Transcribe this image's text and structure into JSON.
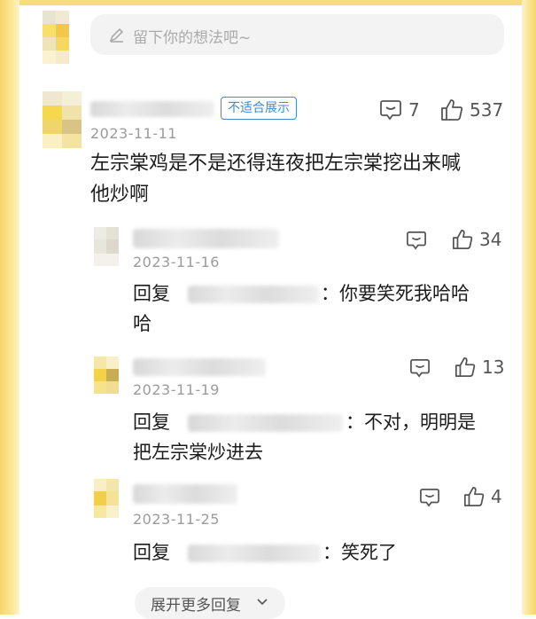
{
  "comment_input": {
    "placeholder": "留下你的想法吧~"
  },
  "main_comment": {
    "badge": "不适合展示",
    "date": "2023-11-11",
    "text_line1": "左宗棠鸡是不是还得连夜把左宗棠挖出来喊",
    "text_line2": "他炒啊",
    "reply_count": "7",
    "like_count": "537"
  },
  "replies": [
    {
      "date": "2023-11-16",
      "prefix": "回复",
      "text_tail": "：你要笑死我哈哈",
      "text_line2": "哈",
      "like_count": "34"
    },
    {
      "date": "2023-11-19",
      "prefix": "回复",
      "text_tail": "：不对，明明是",
      "text_line2": "把左宗棠炒进去",
      "like_count": "13"
    },
    {
      "date": "2023-11-25",
      "prefix": "回复",
      "text_tail": "：笑死了",
      "text_line2": "",
      "like_count": "4"
    }
  ],
  "expand_more": {
    "label": "展开更多回复"
  },
  "icons": {
    "comment": "comment-bubble-icon",
    "like": "thumbs-up-icon",
    "edit": "pencil-icon",
    "expand": "chevron-down-icon"
  },
  "colors": {
    "frame": "#f6d66a",
    "badge": "#3e8ad6",
    "muted": "#9b9b9b"
  }
}
